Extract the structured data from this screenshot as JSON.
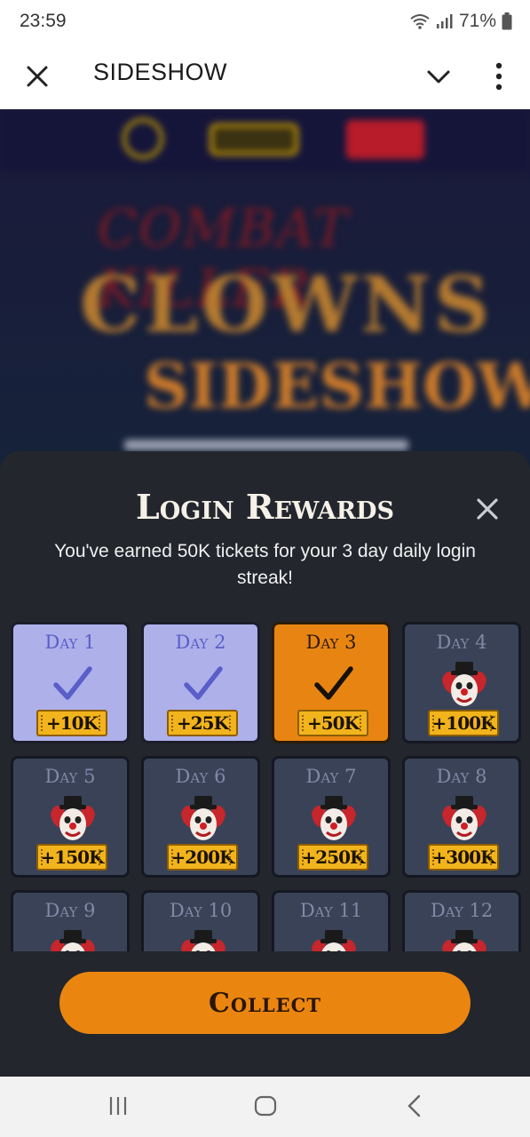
{
  "status_bar": {
    "time": "23:59",
    "battery": "71%"
  },
  "header": {
    "title": "SIDESHOW"
  },
  "game_background": {
    "line1": "COMBAT KILLER",
    "line2": "CLOWNS",
    "line3": "SIDESHOW"
  },
  "modal": {
    "title": "Login Rewards",
    "message": "You've earned 50K tickets for your 3 day daily login streak!",
    "collect_label": "Collect",
    "days": [
      {
        "label": "Day 1",
        "reward": "+10K",
        "state": "claimed"
      },
      {
        "label": "Day 2",
        "reward": "+25K",
        "state": "claimed"
      },
      {
        "label": "Day 3",
        "reward": "+50K",
        "state": "today"
      },
      {
        "label": "Day 4",
        "reward": "+100K",
        "state": "locked"
      },
      {
        "label": "Day 5",
        "reward": "+150K",
        "state": "locked"
      },
      {
        "label": "Day 6",
        "reward": "+200K",
        "state": "locked"
      },
      {
        "label": "Day 7",
        "reward": "+250K",
        "state": "locked"
      },
      {
        "label": "Day 8",
        "reward": "+300K",
        "state": "locked"
      },
      {
        "label": "Day 9",
        "reward": "",
        "state": "locked"
      },
      {
        "label": "Day 10",
        "reward": "",
        "state": "locked"
      },
      {
        "label": "Day 11",
        "reward": "",
        "state": "locked"
      },
      {
        "label": "Day 12",
        "reward": "",
        "state": "locked"
      }
    ]
  },
  "colors": {
    "accent_orange": "#ea8610",
    "claimed_purple": "#aeb0ea",
    "locked_slate": "#3a4257",
    "ticket_gold": "#f2b41c"
  },
  "icons": {
    "claimed": "checkmark-icon",
    "locked": "clown-icon"
  }
}
